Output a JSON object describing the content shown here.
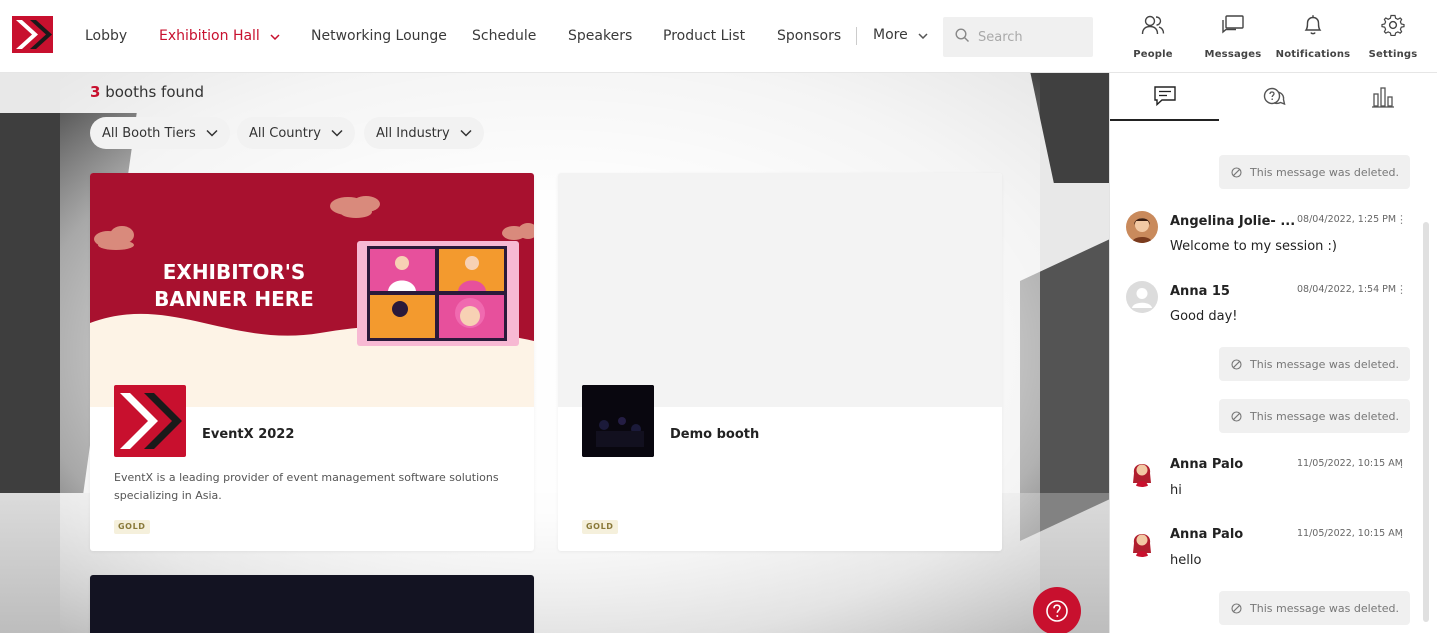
{
  "nav": {
    "items": [
      {
        "label": "Lobby"
      },
      {
        "label": "Exhibition Hall"
      },
      {
        "label": "Networking Lounge"
      },
      {
        "label": "Schedule"
      },
      {
        "label": "Speakers"
      },
      {
        "label": "Product List"
      },
      {
        "label": "Sponsors"
      },
      {
        "label": "More"
      }
    ],
    "search_placeholder": "Search",
    "icons": [
      {
        "label": "People",
        "icon": "people-icon"
      },
      {
        "label": "Messages",
        "icon": "messages-icon"
      },
      {
        "label": "Notifications",
        "icon": "bell-icon"
      },
      {
        "label": "Settings",
        "icon": "gear-icon"
      }
    ]
  },
  "main": {
    "found_count": "3",
    "found_text": " booths found",
    "filters": [
      {
        "label": "All Booth Tiers"
      },
      {
        "label": "All Country"
      },
      {
        "label": "All Industry"
      }
    ],
    "booths": [
      {
        "banner_text": "EXHIBITOR'S BANNER HERE",
        "name": "EventX 2022",
        "description": "EventX is a leading provider of event management software solutions specializing in Asia.",
        "tier": "GOLD"
      },
      {
        "banner_text": "",
        "name": "Demo booth",
        "description": "",
        "tier": "GOLD"
      }
    ]
  },
  "chat": {
    "deleted_text": "This message was deleted.",
    "messages": [
      {
        "name": "Angelina Jolie- ...",
        "time": "08/04/2022, 1:25 PM",
        "text": "Welcome to my session :)"
      },
      {
        "name": "Anna 15",
        "time": "08/04/2022, 1:54 PM",
        "text": "Good day!"
      },
      {
        "name": "Anna Palo",
        "time": "11/05/2022, 10:15 AM",
        "text": "hi"
      },
      {
        "name": "Anna Palo",
        "time": "11/05/2022, 10:15 AM",
        "text": "hello"
      }
    ]
  },
  "colors": {
    "brand_red": "#c8102e",
    "banner_red": "#a8112f"
  }
}
